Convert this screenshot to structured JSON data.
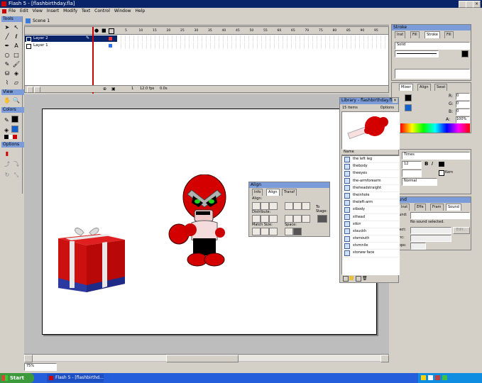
{
  "window": {
    "title": "Flash 5 - [flashbirthday.fla]"
  },
  "menu": [
    "File",
    "Edit",
    "View",
    "Insert",
    "Modify",
    "Text",
    "Control",
    "Window",
    "Help"
  ],
  "toolbox": {
    "tools_label": "Tools",
    "view_label": "View",
    "colors_label": "Colors",
    "options_label": "Options"
  },
  "timeline": {
    "scene": "Scene 1",
    "layers": [
      {
        "name": "Layer 2"
      },
      {
        "name": "Layer 1"
      }
    ],
    "frame_ticks": [
      "5",
      "10",
      "15",
      "20",
      "25",
      "30",
      "35",
      "40",
      "45",
      "50",
      "55",
      "60",
      "65",
      "70",
      "75",
      "80",
      "85",
      "90",
      "95",
      "100"
    ],
    "status": {
      "frame": "1",
      "fps": "12.0 fps",
      "time": "0.0s"
    }
  },
  "library": {
    "title": "Library - flashbirthday.fla",
    "count": "15 items",
    "options": "Options",
    "column_name": "Name",
    "items": [
      "the left leg",
      "thebody",
      "theeyes",
      "the-armforearm",
      "theheadstraight",
      "theinhole",
      "theleft-arm",
      "stbody",
      "sthead",
      "stkrr",
      "stsuckh",
      "stsmouth",
      "stvmnile",
      "stonew face"
    ]
  },
  "align_panel": {
    "title": "Align",
    "tabs": [
      "Info",
      "Align",
      "Transf"
    ],
    "align_label": "Align:",
    "distribute_label": "Distribute:",
    "match_size_label": "Match Size:",
    "space_label": "Space:",
    "to_stage_label": "To Stage:"
  },
  "stroke_panel": {
    "title": "Stroke",
    "tabs": [
      "Inst",
      "Fill",
      "Stroke",
      "Fill"
    ],
    "style": "Solid"
  },
  "mixer_panel": {
    "tabs": [
      "Mixer",
      "Align",
      "Swat"
    ],
    "r": "0",
    "g": "0",
    "b": "0",
    "alpha": "100%"
  },
  "character_panel": {
    "font": "Times",
    "size": "12",
    "kerning_label": "Kern",
    "paragraph": "Normal"
  },
  "sound_panel": {
    "title": "Sound",
    "tabs": [
      "Inst",
      "Effe",
      "Fram",
      "Sound"
    ],
    "sound_label": "Sound:",
    "effect_label": "Effect:",
    "sync_label": "Sync:",
    "loops_label": "Loops:",
    "edit_button": "Edit...",
    "no_sound": "No sound selected."
  },
  "zoom": "75%",
  "taskbar": {
    "start": "Start",
    "task": "Flash 5 - [flashbirthd..."
  },
  "colors": {
    "title_blue": "#0a246a",
    "hero_red": "#d40000",
    "box_red": "#cc1010",
    "box_blue": "#2a3aa0"
  }
}
